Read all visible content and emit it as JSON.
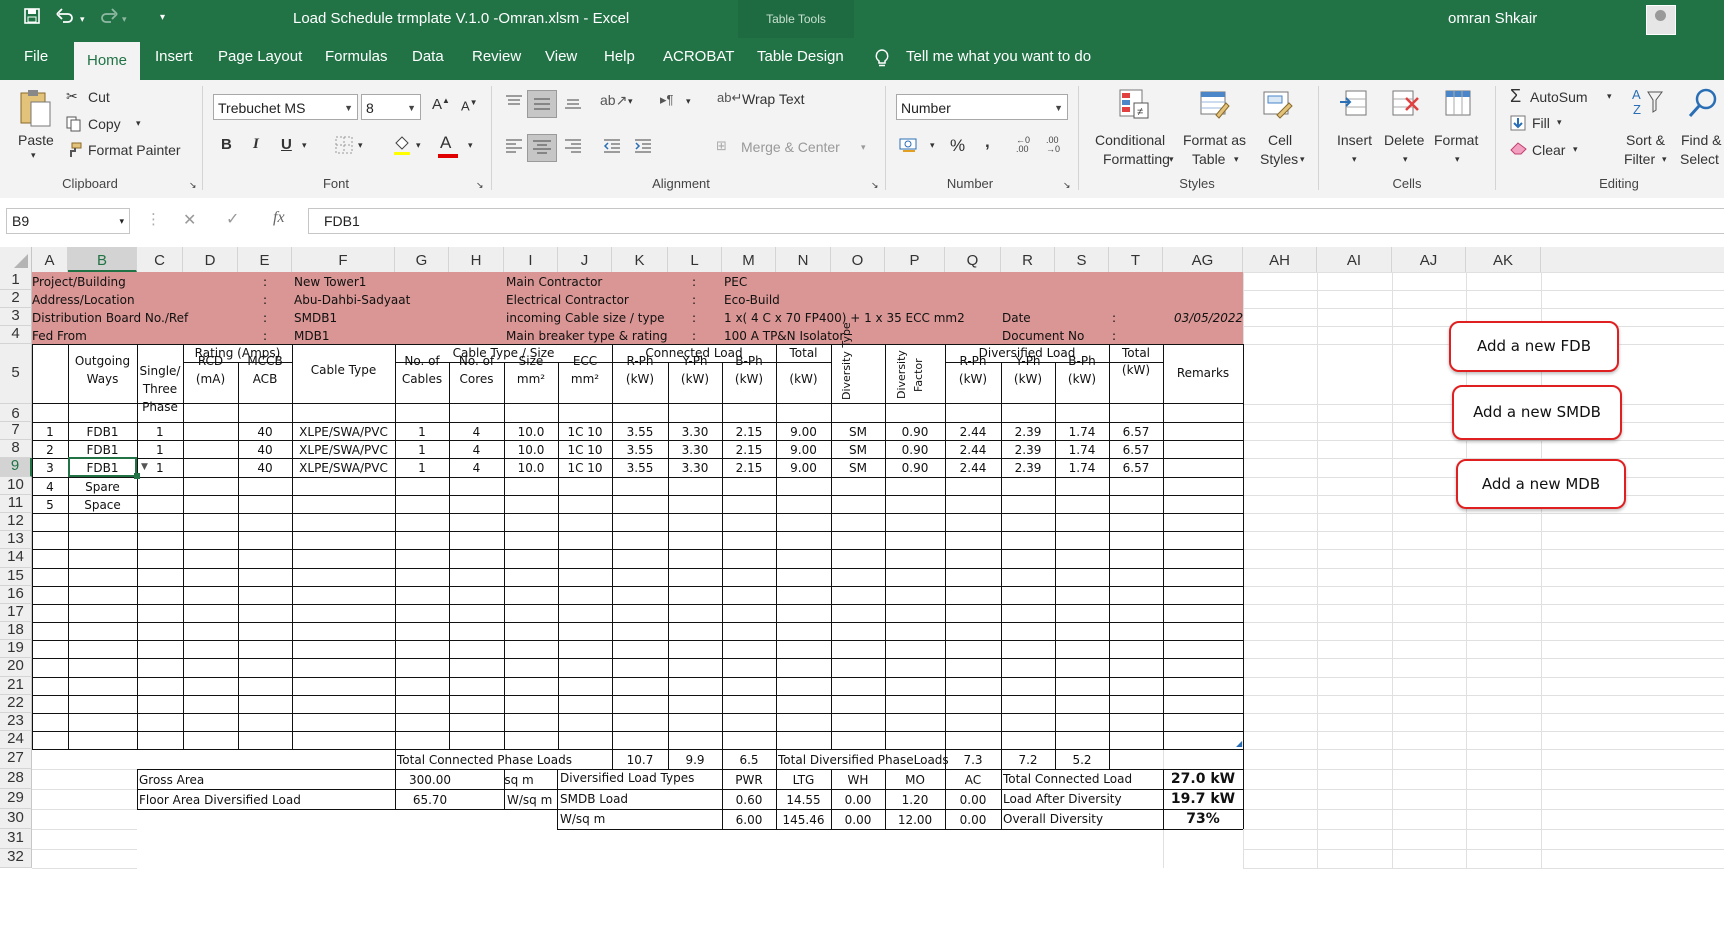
{
  "window": {
    "title": "Load Schedule trmplate V.1.0 -Omran.xlsm  -  Excel",
    "context_tab": "Table Tools",
    "user": "omran Shkair"
  },
  "tabs": [
    "File",
    "Home",
    "Insert",
    "Page Layout",
    "Formulas",
    "Data",
    "Review",
    "View",
    "Help",
    "ACROBAT",
    "Table Design"
  ],
  "tell_me": "Tell me what you want to do",
  "ribbon": {
    "clipboard": {
      "paste": "Paste",
      "cut": "Cut",
      "copy": "Copy",
      "format_painter": "Format Painter",
      "label": "Clipboard"
    },
    "font": {
      "name": "Trebuchet MS",
      "size": "8",
      "label": "Font",
      "bold": "B",
      "italic": "I",
      "underline": "U"
    },
    "alignment": {
      "wrap": "Wrap Text",
      "merge": "Merge & Center",
      "label": "Alignment"
    },
    "number": {
      "format": "Number",
      "label": "Number",
      "percent": "%",
      "comma": ","
    },
    "styles": {
      "conditional": "Conditional",
      "conditional2": "Formatting",
      "format_table": "Format as",
      "format_table2": "Table",
      "cell_styles": "Cell",
      "cell_styles2": "Styles",
      "label": "Styles"
    },
    "cells": {
      "insert": "Insert",
      "delete": "Delete",
      "format": "Format",
      "label": "Cells"
    },
    "editing": {
      "autosum": "AutoSum",
      "fill": "Fill",
      "clear": "Clear",
      "sort": "Sort &",
      "sort2": "Filter",
      "find": "Find &",
      "find2": "Select",
      "label": "Editing"
    }
  },
  "formula_bar": {
    "name_box": "B9",
    "fx": "fx",
    "content": "FDB1"
  },
  "columns": [
    "A",
    "B",
    "C",
    "D",
    "E",
    "F",
    "G",
    "H",
    "I",
    "J",
    "K",
    "L",
    "M",
    "N",
    "O",
    "P",
    "Q",
    "R",
    "S",
    "T",
    "AG",
    "AH",
    "AI",
    "AJ",
    "AK"
  ],
  "rows": [
    "1",
    "2",
    "3",
    "4",
    "5",
    "6",
    "7",
    "8",
    "9",
    "10",
    "11",
    "12",
    "13",
    "14",
    "15",
    "16",
    "17",
    "18",
    "19",
    "20",
    "21",
    "22",
    "23",
    "24",
    "27",
    "28",
    "29",
    "30",
    "31",
    "32"
  ],
  "info": {
    "project_label": "Project/Building",
    "project": "New Tower1",
    "address_label": "Address/Location",
    "address": "Abu-Dahbi-Sadyaat",
    "db_label": "Distribution Board No./Ref",
    "db": "SMDB1",
    "fed_label": "Fed From",
    "fed": "MDB1",
    "main_contractor_label": "Main Contractor",
    "main_contractor": "PEC",
    "elec_contractor_label": "Electrical Contractor",
    "elec_contractor": "Eco-Build",
    "cable_label": "incoming Cable size / type",
    "cable": "1 x( 4 C x 70 FP400) + 1 x 35 ECC mm2",
    "breaker_label": "Main breaker type & rating",
    "breaker": "100 A TP&N Isolator",
    "date_label": "Date",
    "date": "03/05/2022",
    "docno_label": "Document No",
    "colon": ":"
  },
  "headers": {
    "outgoing": "Outgoing",
    "ways": "Ways",
    "single": "Single/",
    "three": "Three",
    "phase": "Phase",
    "rating": "Rating (Amps)",
    "rcd": "RCD",
    "ma": "(mA)",
    "mccb": "MCCB",
    "acb": "ACB",
    "cable_type": "Cable Type",
    "cable_group": "Cable Type / Size",
    "no_of": "No. of",
    "cables": "Cables",
    "cores": "Cores",
    "size": "Size",
    "mm2": "mm²",
    "ecc": "ECC",
    "connected": "Connected Load",
    "rph": "R-Ph",
    "yph": "Y-Ph",
    "bph": "B-Ph",
    "kw": "(kW)",
    "total": "Total",
    "diversity_type": "Diversity Type",
    "diversity_factor": "Diversity Factor",
    "diversified": "Diversified Load",
    "remarks": "Remarks"
  },
  "table_rows": [
    {
      "no": "1",
      "ways": "FDB1",
      "phase": "1",
      "rcd": "",
      "mccb": "40",
      "cable": "XLPE/SWA/PVC",
      "cables": "1",
      "cores": "4",
      "size": "10.0",
      "ecc": "1C 10",
      "r": "3.55",
      "y": "3.30",
      "b": "2.15",
      "total": "9.00",
      "dtype": "SM",
      "dfactor": "0.90",
      "dr": "2.44",
      "dy": "2.39",
      "db": "1.74",
      "dtotal": "6.57"
    },
    {
      "no": "2",
      "ways": "FDB1",
      "phase": "1",
      "rcd": "",
      "mccb": "40",
      "cable": "XLPE/SWA/PVC",
      "cables": "1",
      "cores": "4",
      "size": "10.0",
      "ecc": "1C 10",
      "r": "3.55",
      "y": "3.30",
      "b": "2.15",
      "total": "9.00",
      "dtype": "SM",
      "dfactor": "0.90",
      "dr": "2.44",
      "dy": "2.39",
      "db": "1.74",
      "dtotal": "6.57"
    },
    {
      "no": "3",
      "ways": "FDB1",
      "phase": "1",
      "rcd": "",
      "mccb": "40",
      "cable": "XLPE/SWA/PVC",
      "cables": "1",
      "cores": "4",
      "size": "10.0",
      "ecc": "1C 10",
      "r": "3.55",
      "y": "3.30",
      "b": "2.15",
      "total": "9.00",
      "dtype": "SM",
      "dfactor": "0.90",
      "dr": "2.44",
      "dy": "2.39",
      "db": "1.74",
      "dtotal": "6.57"
    },
    {
      "no": "4",
      "ways": "Spare"
    },
    {
      "no": "5",
      "ways": "Space"
    }
  ],
  "totals": {
    "connected_label": "Total Connected Phase Loads",
    "r": "10.7",
    "y": "9.9",
    "b": "6.5",
    "diversified_label": "Total Diversified PhaseLoads",
    "dr": "7.3",
    "dy": "7.2",
    "db": "5.2"
  },
  "summary": {
    "gross_area_label": "Gross Area",
    "gross_area": "300.00",
    "gross_unit": "sq m",
    "floor_label": "Floor Area Diversified Load",
    "floor": "65.70",
    "floor_unit": "W/sq m",
    "types_label": "Diversified Load Types",
    "smdb_label": "SMDB Load",
    "wsqm_label": "W/sq m",
    "types": [
      "PWR",
      "LTG",
      "WH",
      "MO",
      "AC"
    ],
    "smdb": [
      "0.60",
      "14.55",
      "0.00",
      "1.20",
      "0.00"
    ],
    "wsqm": [
      "6.00",
      "145.46",
      "0.00",
      "12.00",
      "0.00"
    ],
    "tcl_label": "Total Connected Load",
    "tcl": "27.0 kW",
    "lad_label": "Load After Diversity",
    "lad": "19.7 kW",
    "od_label": "Overall Diversity",
    "od": "73%"
  },
  "buttons": {
    "fdb": "Add a new FDB",
    "smdb": "Add a new SMDB",
    "mdb": "Add a new MDB"
  },
  "colors": {
    "excel_green": "#217346",
    "header_pink": "#d99694",
    "button_border": "#e02020"
  }
}
